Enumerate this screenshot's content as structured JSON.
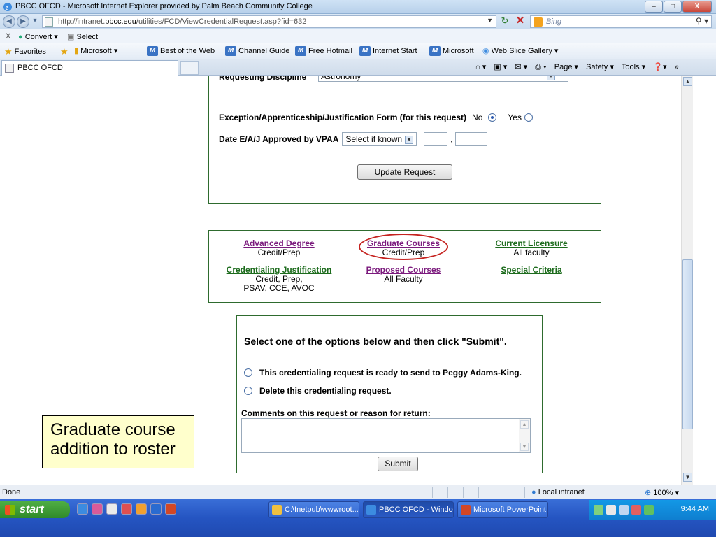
{
  "window": {
    "title": "PBCC OFCD - Microsoft Internet Explorer provided by Palm Beach Community College",
    "minimize": "–",
    "maximize": "□",
    "close": "X"
  },
  "addressbar": {
    "url_prefix": "http://intranet.",
    "url_domain": "pbcc.edu",
    "url_path": "/utilities/FCD/ViewCredentialRequest.asp?fid=632",
    "search_placeholder": "Bing"
  },
  "commandbar": {
    "close_label": "X",
    "convert_label": "Convert ▾",
    "select_label": "Select"
  },
  "favorites": {
    "favorites_label": "Favorites",
    "items": [
      "Microsoft ▾",
      "Best of the Web",
      "Channel Guide",
      "Free Hotmail",
      "Internet Start",
      "Microsoft",
      "Web Slice Gallery ▾"
    ]
  },
  "tabs": {
    "active_label": "PBCC OFCD",
    "tools": [
      "Page ▾",
      "Safety ▾",
      "Tools ▾"
    ]
  },
  "request_form": {
    "discipline_label": "Requesting Discipline",
    "discipline_value": "Astronomy",
    "exception_label": "Exception/Apprenticeship/Justification Form (for this request)",
    "no_label": "No",
    "yes_label": "Yes",
    "selected": "No",
    "date_label": "Date E/A/J Approved by VPAA",
    "date_select": "Select if known",
    "date_separator": ",",
    "update_button": "Update Request"
  },
  "credential_links": [
    {
      "title": "Advanced Degree",
      "sub": "Credit/Prep",
      "color": "#7b1a7d"
    },
    {
      "title": "Graduate Courses",
      "sub": "Credit/Prep",
      "color": "#7b1a7d"
    },
    {
      "title": "Current Licensure",
      "sub": "All faculty",
      "color": "#1c6b1c"
    },
    {
      "title": "Credentialing Justification",
      "sub": "Credit, Prep,",
      "sub2": "PSAV, CCE, AVOC",
      "color": "#1c6b1c"
    },
    {
      "title": "Proposed Courses",
      "sub": "All Faculty",
      "color": "#7b1a7d"
    },
    {
      "title": "Special Criteria",
      "sub": "",
      "color": "#1c6b1c"
    }
  ],
  "submit_form": {
    "instruction": "Select one of the options below and then click \"Submit\".",
    "option1": "This credentialing request is ready to send to Peggy Adams-King.",
    "option2": "Delete this credentialing request.",
    "comment_label": "Comments on this request or reason for return:",
    "submit_button": "Submit"
  },
  "callout": {
    "line1": "Graduate course",
    "line2": "addition to roster"
  },
  "statusbar": {
    "status": "Done",
    "zone": "Local intranet",
    "zoom": "100%"
  },
  "taskbar": {
    "start_label": "start",
    "tasks": [
      "C:\\Inetpub\\wwwroot...",
      "PBCC OFCD - Windo...",
      "Microsoft PowerPoint ..."
    ],
    "clock": "9:44 AM"
  }
}
